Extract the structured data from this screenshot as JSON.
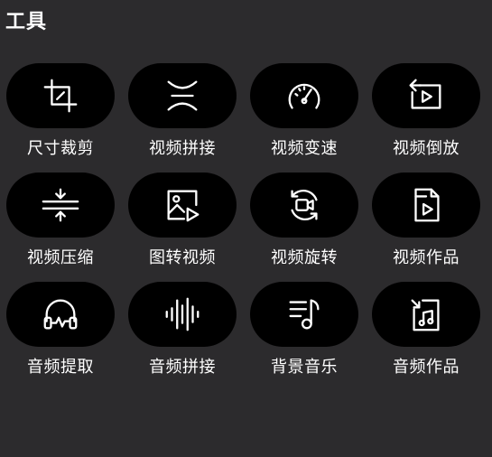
{
  "title": "工具",
  "tools": [
    {
      "label": "尺寸裁剪",
      "icon": "crop-icon"
    },
    {
      "label": "视频拼接",
      "icon": "video-join-icon"
    },
    {
      "label": "视频变速",
      "icon": "speedometer-icon"
    },
    {
      "label": "视频倒放",
      "icon": "video-reverse-icon"
    },
    {
      "label": "视频压缩",
      "icon": "compress-icon"
    },
    {
      "label": "图转视频",
      "icon": "image-to-video-icon"
    },
    {
      "label": "视频旋转",
      "icon": "video-rotate-icon"
    },
    {
      "label": "视频作品",
      "icon": "video-file-icon"
    },
    {
      "label": "音频提取",
      "icon": "headphones-icon"
    },
    {
      "label": "音频拼接",
      "icon": "audio-waveform-icon"
    },
    {
      "label": "背景音乐",
      "icon": "music-list-icon"
    },
    {
      "label": "音频作品",
      "icon": "music-file-icon"
    }
  ]
}
